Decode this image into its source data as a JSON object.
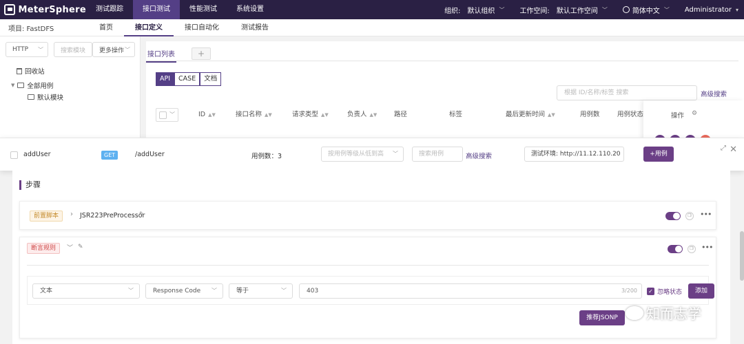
{
  "topbar": {
    "brand": "MeterSphere",
    "nav": [
      "测试跟踪",
      "接口测试",
      "性能测试",
      "系统设置"
    ],
    "org_label": "组织:",
    "org_value": "默认组织",
    "workspace_label": "工作空间:",
    "workspace_value": "默认工作空间",
    "language": "简体中文",
    "user": "Administrator"
  },
  "subbar": {
    "project": "项目: FastDFS",
    "nav": [
      "首页",
      "接口定义",
      "接口自动化",
      "测试报告"
    ]
  },
  "left": {
    "protocol": "HTTP",
    "search_placeholder": "搜索模块",
    "more_ops": "更多操作",
    "recycle": "回收站",
    "all_cases": "全部用例",
    "default_module": "默认模块"
  },
  "main": {
    "tab": "接口列表",
    "tab_add": "+",
    "seg": [
      "API",
      "CASE",
      "文档"
    ],
    "search_placeholder": "根据 ID/名称/标签 搜索",
    "advanced": "高级搜索",
    "columns": [
      "ID",
      "接口名称",
      "请求类型",
      "负责人",
      "路径",
      "标签",
      "最后更新时间",
      "用例数",
      "用例状态",
      "操作"
    ]
  },
  "drawer": {
    "name": "addUser",
    "method": "GET",
    "path": "/addUser",
    "case_count": "用例数：3",
    "sort_placeholder": "按用例等级从低到高",
    "case_search_placeholder": "搜索用例",
    "advanced": "高级搜索",
    "env": "测试环境: http://11.12.110.20",
    "add_case": "+用例"
  },
  "steps": {
    "title": "步骤",
    "pre_tag": "前置脚本",
    "pre_name": "JSR223PreProcessor",
    "assert_tag": "断言规则",
    "rule_type": "文本",
    "rule_field": "Response Code",
    "rule_op": "等于",
    "rule_value": "403",
    "rule_count": "3/200",
    "ignore_status": "忽略状态",
    "add": "添加",
    "recommend": "推荐JSONP"
  },
  "watermark": "知而志学",
  "colors": {
    "nav_bg": "#2a2044",
    "accent": "#6b3f86",
    "get": "#5eb1f0"
  }
}
